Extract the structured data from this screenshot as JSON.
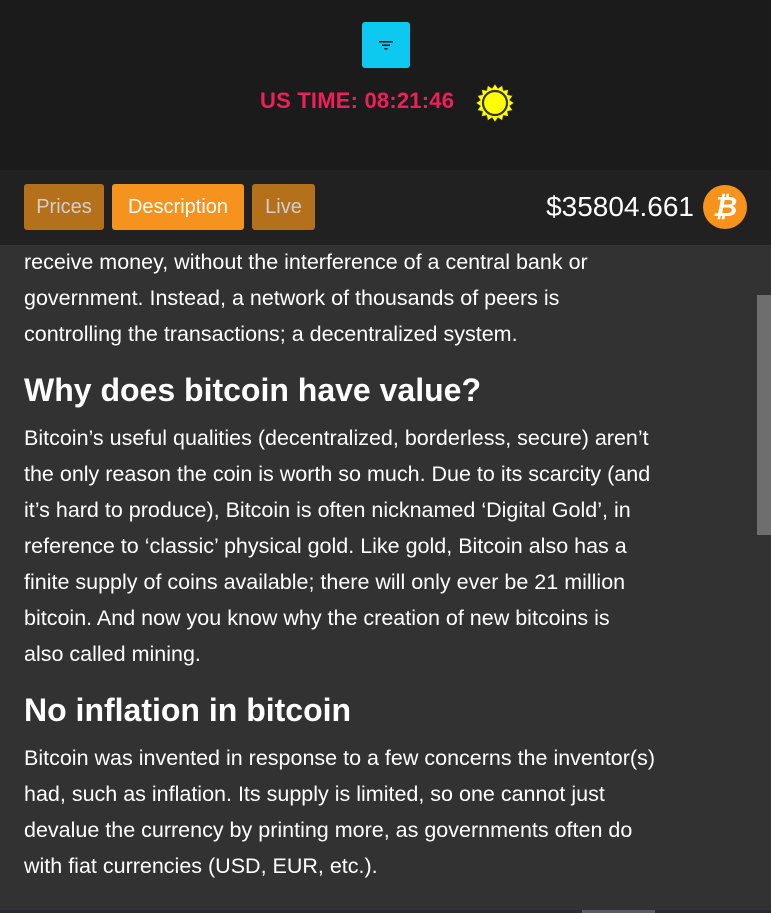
{
  "header": {
    "filter_icon": "filter-icon",
    "time_label": "US TIME: 08:21:46",
    "theme_icon": "sun-icon",
    "colors": {
      "filter_button": "#0dc9ef",
      "time": "#ee1f5b",
      "sun": "#ffff00"
    }
  },
  "nav": {
    "tabs": [
      {
        "label": "Prices",
        "active": false
      },
      {
        "label": "Description",
        "active": true
      },
      {
        "label": "Live",
        "active": false
      }
    ],
    "price": "$35804.661",
    "coin_icon": "bitcoin-icon"
  },
  "content": {
    "intro_lines": [
      "receive money, without the interference of a central bank or",
      "government. Instead, a network of thousands of peers is",
      "controlling the transactions; a decentralized system."
    ],
    "sections": [
      {
        "heading": "Why does bitcoin have value?",
        "lines": [
          "Bitcoin’s useful qualities (decentralized, borderless, secure) aren’t",
          "the only reason the coin is worth so much. Due to its scarcity (and",
          "it’s hard to produce), Bitcoin is often nicknamed ‘Digital Gold’, in",
          "reference to ‘classic’ physical gold. Like gold, Bitcoin also has a",
          "finite supply of coins available; there will only ever be 21 million",
          "bitcoin. And now you know why the creation of new bitcoins is",
          "also called mining."
        ]
      },
      {
        "heading": "No inflation in bitcoin",
        "lines": [
          "Bitcoin was invented in response to a few concerns the inventor(s)",
          "had, such as inflation. Its supply is limited, so one cannot just",
          "devalue the currency by printing more, as governments often do",
          "with fiat currencies (USD, EUR, etc.)."
        ]
      }
    ]
  }
}
